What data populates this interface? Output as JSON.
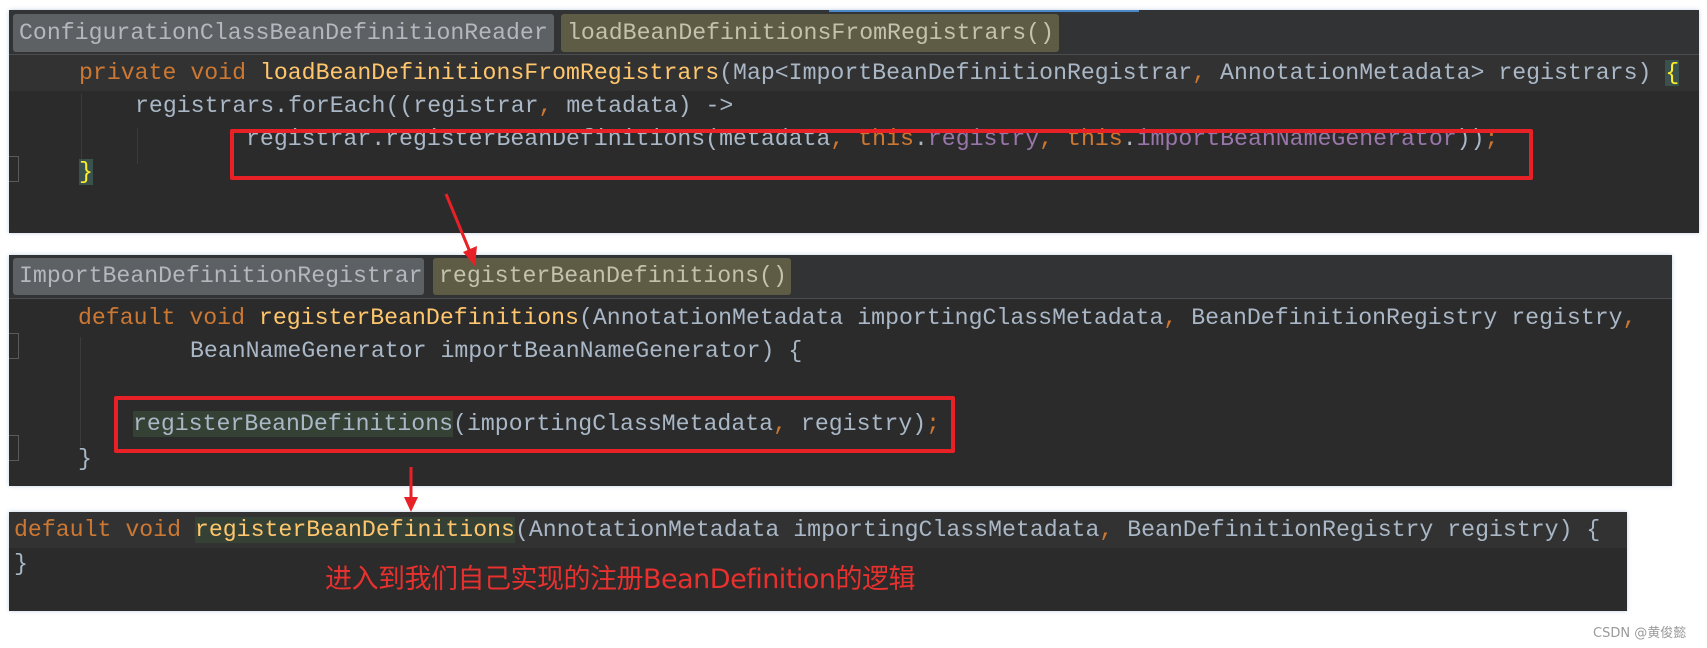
{
  "panels": [
    {
      "breadcrumb": {
        "class_name": "ConfigurationClassBeanDefinitionReader",
        "method_name": "loadBeanDefinitionsFromRegistrars()"
      },
      "lines": [
        {
          "tokens": [
            {
              "t": "private",
              "c": "kw"
            },
            {
              "t": " ",
              "c": "plain"
            },
            {
              "t": "void",
              "c": "kw"
            },
            {
              "t": " ",
              "c": "plain"
            },
            {
              "t": "loadBeanDefinitionsFromRegistrars",
              "c": "fn"
            },
            {
              "t": "(Map<ImportBeanDefinitionRegistrar",
              "c": "plain"
            },
            {
              "t": ",",
              "c": "punct"
            },
            {
              "t": " AnnotationMetadata> registrars) ",
              "c": "plain"
            },
            {
              "t": "{",
              "c": "brace-match"
            }
          ]
        },
        {
          "tokens": [
            {
              "t": "registrars.forEach((registrar",
              "c": "plain"
            },
            {
              "t": ",",
              "c": "punct"
            },
            {
              "t": " metadata) ->",
              "c": "plain"
            }
          ]
        },
        {
          "tokens": [
            {
              "t": "registrar.registerBeanDefinitions(metadata",
              "c": "plain"
            },
            {
              "t": ",",
              "c": "punct"
            },
            {
              "t": " ",
              "c": "plain"
            },
            {
              "t": "this",
              "c": "kw"
            },
            {
              "t": ".",
              "c": "plain"
            },
            {
              "t": "registry",
              "c": "fld"
            },
            {
              "t": ",",
              "c": "punct"
            },
            {
              "t": " ",
              "c": "plain"
            },
            {
              "t": "this",
              "c": "kw"
            },
            {
              "t": ".",
              "c": "plain"
            },
            {
              "t": "importBeanNameGenerator",
              "c": "fld"
            },
            {
              "t": "))",
              "c": "paren"
            },
            {
              "t": ";",
              "c": "punct"
            }
          ]
        },
        {
          "tokens": [
            {
              "t": "}",
              "c": "brace-match"
            }
          ]
        }
      ]
    },
    {
      "breadcrumb": {
        "class_name": "ImportBeanDefinitionRegistrar",
        "method_name": "registerBeanDefinitions()"
      },
      "lines": [
        {
          "tokens": [
            {
              "t": "default",
              "c": "kw"
            },
            {
              "t": " ",
              "c": "plain"
            },
            {
              "t": "void",
              "c": "kw"
            },
            {
              "t": " ",
              "c": "plain"
            },
            {
              "t": "registerBeanDefinitions",
              "c": "fn"
            },
            {
              "t": "(AnnotationMetadata importingClassMetadata",
              "c": "plain"
            },
            {
              "t": ",",
              "c": "punct"
            },
            {
              "t": " BeanDefinitionRegistry registry",
              "c": "plain"
            },
            {
              "t": ",",
              "c": "punct"
            }
          ]
        },
        {
          "tokens": [
            {
              "t": "BeanNameGenerator importBeanNameGenerator) {",
              "c": "plain"
            }
          ]
        },
        {
          "tokens": [
            {
              "t": "registerBeanDefinitions",
              "c": "plain hl-usage"
            },
            {
              "t": "(importingClassMetadata",
              "c": "plain"
            },
            {
              "t": ",",
              "c": "punct"
            },
            {
              "t": " registry)",
              "c": "plain"
            },
            {
              "t": ";",
              "c": "punct"
            }
          ]
        },
        {
          "tokens": [
            {
              "t": "}",
              "c": "plain"
            }
          ]
        }
      ]
    },
    {
      "lines": [
        {
          "tokens": [
            {
              "t": "default",
              "c": "kw"
            },
            {
              "t": " ",
              "c": "plain"
            },
            {
              "t": "void",
              "c": "kw"
            },
            {
              "t": " ",
              "c": "plain"
            },
            {
              "t": "registerBeanDefinitions",
              "c": "fn hl-usage"
            },
            {
              "t": "(AnnotationMetadata importingClassMetadata",
              "c": "plain"
            },
            {
              "t": ",",
              "c": "punct"
            },
            {
              "t": " BeanDefinitionRegistry registry) {",
              "c": "plain"
            }
          ]
        },
        {
          "tokens": [
            {
              "t": "}",
              "c": "plain"
            }
          ]
        }
      ]
    }
  ],
  "annotation": {
    "note": "进入到我们自己实现的注册BeanDefinition的逻辑",
    "highlight_color": "#e82127"
  },
  "watermark": "CSDN @黄俊懿",
  "colors": {
    "editor_bg": "#2b2b2b",
    "keyword": "#cc7832",
    "method": "#ffc66d",
    "field": "#9876aa",
    "text": "#a9b7c6"
  }
}
